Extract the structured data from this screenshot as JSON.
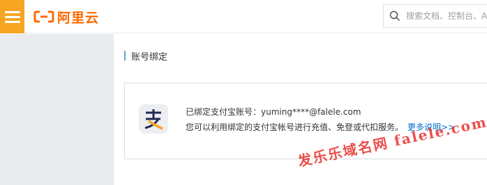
{
  "header": {
    "logo_text": "阿里云",
    "search_placeholder": "搜索文档、控制台、A"
  },
  "page": {
    "section_title": "账号绑定"
  },
  "binding": {
    "line1": "已绑定支付宝账号：yuming****@falele.com",
    "line2": "您可以利用绑定的支付宝帐号进行充值、免登或代扣服务。",
    "more_link": "更多说明>>"
  },
  "watermark": {
    "text": "发乐乐域名网 falele.com"
  },
  "colors": {
    "accent": "#f6a623",
    "brand": "#ff6a00",
    "link": "#0070cc"
  }
}
